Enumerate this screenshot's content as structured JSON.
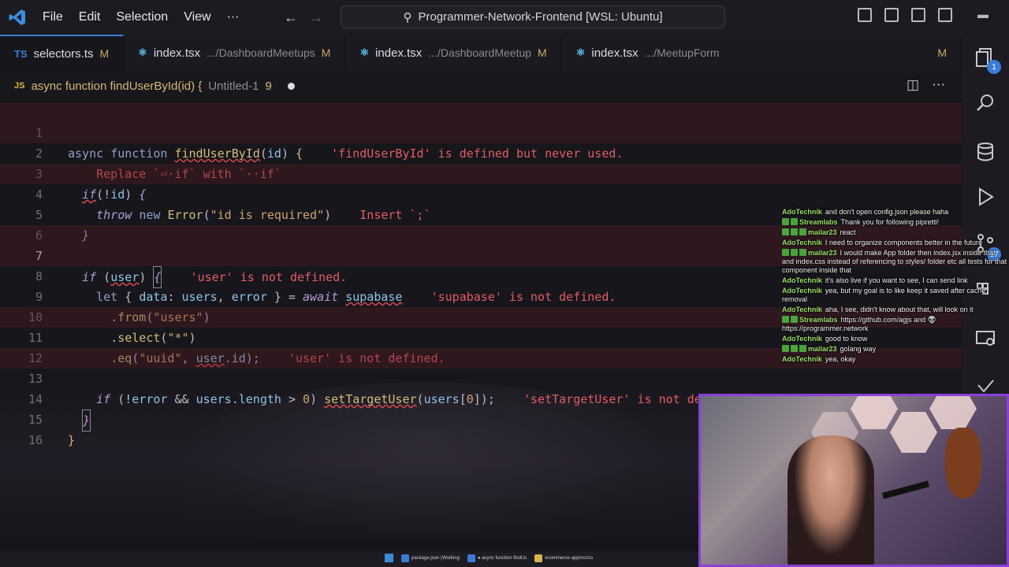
{
  "titlebar": {
    "menu": [
      "File",
      "Edit",
      "Selection",
      "View",
      "···"
    ],
    "search": "Programmer-Network-Frontend [WSL: Ubuntu]"
  },
  "tabs": [
    {
      "name": "selectors.ts",
      "path": "",
      "mod": "M",
      "icon": "TS",
      "active": true
    },
    {
      "name": "index.tsx",
      "path": ".../DashboardMeetups",
      "mod": "M",
      "icon": "⚛",
      "active": false
    },
    {
      "name": "index.tsx",
      "path": ".../DashboardMeetup",
      "mod": "M",
      "icon": "⚛",
      "active": false
    },
    {
      "name": "index.tsx",
      "path": ".../MeetupForm",
      "mod": "M",
      "icon": "⚛",
      "active": false
    }
  ],
  "breadcrumb": {
    "icon": "JS",
    "function": "async function findUserById(id) {",
    "file": "Untitled-1",
    "count": "9"
  },
  "code": {
    "l1": {
      "n": "1",
      "msg": "'findUserById' is defined but never used."
    },
    "l2": {
      "n": "2",
      "msg": "Replace `⏎·if` with `··if`"
    },
    "l3": {
      "n": "3"
    },
    "l4": {
      "n": "4",
      "msg": "Insert `;`"
    },
    "l5": {
      "n": "5"
    },
    "l6": {
      "n": "6"
    },
    "l7": {
      "n": "7",
      "msg": "'user' is not defined."
    },
    "l8": {
      "n": "8",
      "msg": "'supabase' is not defined."
    },
    "l9": {
      "n": "9"
    },
    "l10": {
      "n": "10"
    },
    "l11": {
      "n": "11",
      "msg": "'user' is not defined."
    },
    "l12": {
      "n": "12"
    },
    "l13": {
      "n": "13",
      "msg": "'setTargetUser' is not defined."
    },
    "l14": {
      "n": "14"
    },
    "l15": {
      "n": "15"
    },
    "l16": {
      "n": "16"
    }
  },
  "activity_badges": {
    "scm": "1",
    "extensions": "17"
  },
  "chat": [
    {
      "user": "AdoTechnik",
      "badges": 0,
      "text": "and don't open config.json please haha"
    },
    {
      "user": "Streamlabs",
      "badges": 2,
      "text": "Thank you for following pipretti!"
    },
    {
      "user": "mailar23",
      "badges": 3,
      "text": "react"
    },
    {
      "user": "AdoTechnik",
      "badges": 0,
      "text": "I need to organize components better in the future"
    },
    {
      "user": "mailar23",
      "badges": 3,
      "text": "I would make App folder then index.jsx inside that and index.css instead of referencing to styles/ folder etc all tests for that component inside that"
    },
    {
      "user": "AdoTechnik",
      "badges": 0,
      "text": "it's also live if you want to see, I can send link"
    },
    {
      "user": "AdoTechnik",
      "badges": 0,
      "text": "yea, but my goal is to like keep it saved after cache removal"
    },
    {
      "user": "AdoTechnik",
      "badges": 0,
      "text": "aha, I see, didn't know about that, will look on it"
    },
    {
      "user": "Streamlabs",
      "badges": 2,
      "text": "https://github.com/agjs and 👽 https://programmer.network"
    },
    {
      "user": "AdoTechnik",
      "badges": 0,
      "text": "good to know"
    },
    {
      "user": "mailar23",
      "badges": 3,
      "text": "golang way"
    },
    {
      "user": "AdoTechnik",
      "badges": 0,
      "text": "yea, okay"
    }
  ],
  "taskbar": [
    {
      "label": "package.json (Working"
    },
    {
      "label": "● async function findUs"
    },
    {
      "label": "ecommerce-app/src/co"
    }
  ]
}
